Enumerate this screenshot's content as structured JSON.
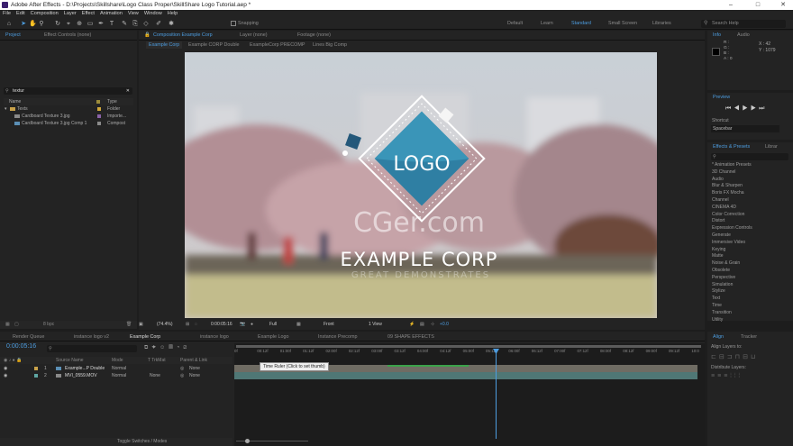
{
  "app": {
    "title": "Adobe After Effects - D:\\Projects\\Skillshare\\Logo Class Proper\\SkillShare Logo Tutorial.aep *"
  },
  "menu": [
    "File",
    "Edit",
    "Composition",
    "Layer",
    "Effect",
    "Animation",
    "View",
    "Window",
    "Help"
  ],
  "toolbar": {
    "snapping": "Snapping",
    "search_placeholder": "Search Help"
  },
  "workspaces": [
    "Default",
    "Learn",
    "Standard",
    "Small Screen",
    "Libraries"
  ],
  "project": {
    "tabs": [
      "Project",
      "Effect Controls (none)"
    ],
    "search_value": "textur",
    "col_name": "Name",
    "col_type": "Type",
    "items": [
      {
        "name": "Texts",
        "type": "Folder"
      },
      {
        "name": "Cardboard Texture 3.jpg",
        "type": "Importe..."
      },
      {
        "name": "Cardboard Texture 3.jpg Comp 1",
        "type": "Compost"
      }
    ],
    "bpc": "8 bpc"
  },
  "comp": {
    "tabs": [
      "Composition Example Corp",
      "Layer (none)",
      "Footage (none)"
    ],
    "subtabs": [
      "Example Corp",
      "Example CORP Double",
      "ExampleCorp PRECOMP",
      "Lines Big Comp"
    ],
    "logo_text": "LOGO",
    "watermark": "CGer.com",
    "company": "EXAMPLE CORP",
    "tagline": "GREAT DEMONSTRATES",
    "zoom": "(74.4%)",
    "time": "0:00:05:16",
    "res": "Full",
    "camera": "Front",
    "views": "1 View",
    "exposure": "+0.0"
  },
  "info": {
    "tabs": [
      "Info",
      "Audio"
    ],
    "x": "X : 42",
    "y": "Y : 1079",
    "channels": [
      "R :",
      "G :",
      "B :",
      "A : 0"
    ]
  },
  "preview": {
    "title": "Preview",
    "shortcut_label": "Shortcut",
    "shortcut_value": "Spacebar"
  },
  "effects": {
    "tabs": [
      "Effects & Presets",
      "Librar"
    ],
    "items": [
      "* Animation Presets",
      "3D Channel",
      "Audio",
      "Blur & Sharpen",
      "Boris FX Mocha",
      "Channel",
      "CINEMA 4D",
      "Color Correction",
      "Distort",
      "Expression Controls",
      "Generate",
      "Immersive Video",
      "Keying",
      "Matte",
      "Noise & Grain",
      "Obsolete",
      "Perspective",
      "Simulation",
      "Stylize",
      "Text",
      "Time",
      "Transition",
      "Utility"
    ]
  },
  "timeline": {
    "tabs": [
      "Render Queue",
      "instance logo v2",
      "Example Corp",
      "instance logo",
      "Example Logo",
      "Instance Precomp",
      "09 SHAPE EFFECTS"
    ],
    "time": "0:00:05:16",
    "cols": [
      "Source Name",
      "Mode",
      "T TrkMat",
      "Parent & Link"
    ],
    "layers": [
      {
        "num": "1",
        "name": "Example...P Double",
        "mode": "Normal",
        "trk": "",
        "parent": "None"
      },
      {
        "num": "2",
        "name": "MVI_0559.MOV",
        "mode": "Normal",
        "trk": "None",
        "parent": "None"
      }
    ],
    "ticks": [
      "0f",
      "00:12f",
      "01:00f",
      "01:12f",
      "02:00f",
      "02:12f",
      "03:00f",
      "03:12f",
      "04:00f",
      "04:12f",
      "05:00f",
      "05:12f",
      "06:00f",
      "06:12f",
      "07:00f",
      "07:12f",
      "08:00f",
      "08:12f",
      "09:00f",
      "09:12f",
      "10:0"
    ],
    "tooltip": "Time Ruler (Click to set thumb)",
    "toggle": "Toggle Switches / Modes"
  },
  "align": {
    "tabs": [
      "Align",
      "Tracker"
    ],
    "align_to": "Align Layers to:",
    "distribute": "Distribute Layers:"
  }
}
